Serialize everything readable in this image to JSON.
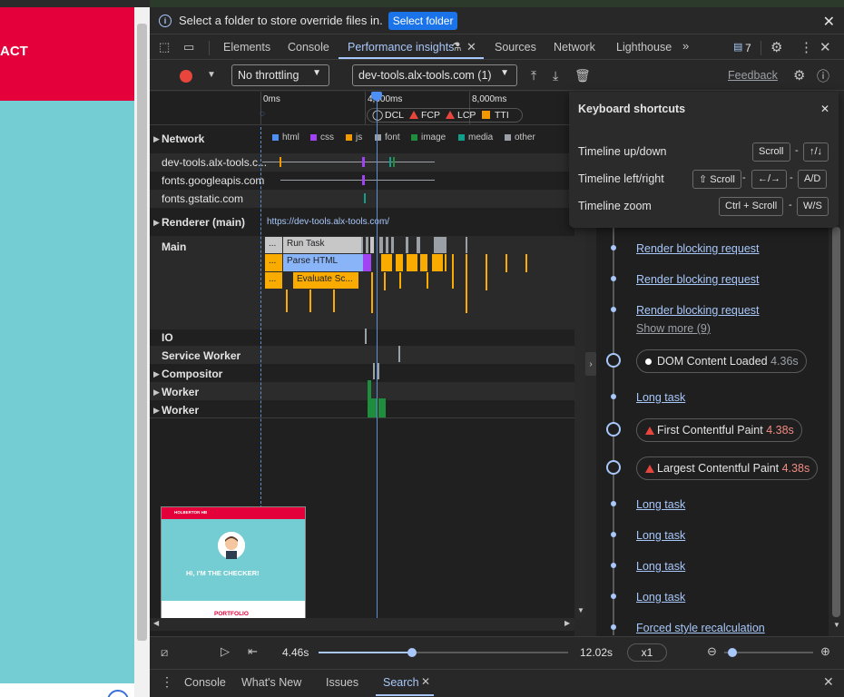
{
  "page": {
    "hero_text": "ACT"
  },
  "infobar": {
    "text": "Select a folder to store override files in.",
    "button": "Select folder"
  },
  "tabs": [
    "Elements",
    "Console",
    "Performance insights",
    "Sources",
    "Network",
    "Lighthouse"
  ],
  "issues_count": "7",
  "toolbar": {
    "throttling": "No throttling",
    "recording": "dev-tools.alx-tools.com (1)",
    "feedback": "Feedback"
  },
  "ruler": {
    "t0": "0ms",
    "t1": "4,000ms",
    "t2": "8,000ms",
    "markers": [
      "DCL",
      "FCP",
      "LCP",
      "TTI"
    ]
  },
  "network": {
    "label": "Network",
    "legend": [
      "html",
      "css",
      "js",
      "font",
      "image",
      "media",
      "other"
    ],
    "legend_colors": [
      "#4e8ff5",
      "#a142f4",
      "#f29900",
      "#9aa0a6",
      "#1e8e3e",
      "#129e8a",
      "#9aa0a6"
    ],
    "hosts": [
      "dev-tools.alx-tools.c...",
      "fonts.googleapis.com",
      "fonts.gstatic.com"
    ]
  },
  "renderer": {
    "label": "Renderer (main)",
    "url": "https://dev-tools.alx-tools.com/"
  },
  "tracks": {
    "main": "Main",
    "io": "IO",
    "service_worker": "Service Worker",
    "compositor": "Compositor",
    "worker1": "Worker",
    "worker2": "Worker"
  },
  "tasks": {
    "run": "Run Task",
    "parse": "Parse HTML",
    "eval": "Evaluate Sc...",
    "dots": "..."
  },
  "thumbnail": {
    "brand": "HOLBERTON HB",
    "title": "HI, I'M THE CHECKER!",
    "portfolio": "PORTFOLIO"
  },
  "shortcuts": {
    "title": "Keyboard shortcuts",
    "rows": [
      {
        "label": "Timeline up/down",
        "keys": [
          "Scroll",
          "↑/↓"
        ]
      },
      {
        "label": "Timeline left/right",
        "keys": [
          "⇧ Scroll",
          "←/→",
          "A/D"
        ]
      },
      {
        "label": "Timeline zoom",
        "keys": [
          "Ctrl + Scroll",
          "W/S"
        ]
      }
    ]
  },
  "insights": {
    "render_blocking": "Render blocking request",
    "show_more": "Show more (9)",
    "dcl": {
      "label": "DOM Content Loaded",
      "time": "4.36s"
    },
    "long_task": "Long task",
    "fcp": {
      "label": "First Contentful Paint",
      "time": "4.38s"
    },
    "lcp": {
      "label": "Largest Contentful Paint",
      "time": "4.38s"
    },
    "forced": "Forced style recalculation"
  },
  "playback": {
    "current": "4.46s",
    "total": "12.02s",
    "speed": "x1",
    "progress_fraction": 0.37
  },
  "drawer": {
    "items": [
      "Console",
      "What's New",
      "Issues",
      "Search"
    ]
  }
}
